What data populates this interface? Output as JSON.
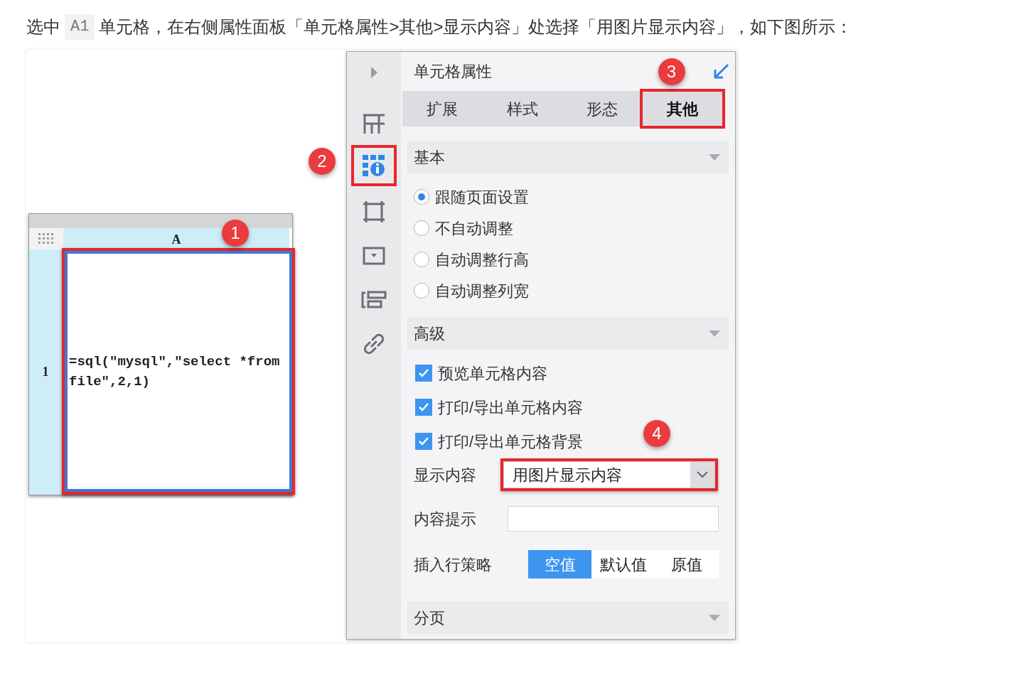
{
  "intro": {
    "before": "选中",
    "code": "A1",
    "after": "单元格，在右侧属性面板「单元格属性>其他>显示内容」处选择「用图片显示内容」，如下图所示："
  },
  "sheet": {
    "column_header": "A",
    "row_header": "1",
    "cell": {
      "value": "=sql(\"mysql\",\"select *from file\",2,1)",
      "selected": true,
      "highlighted": true,
      "badge": "1"
    }
  },
  "panel": {
    "title": "单元格属性",
    "rail_icons": [
      {
        "kind": "collapse",
        "selected": false,
        "highlighted": false
      },
      {
        "kind": "expand",
        "selected": false,
        "highlighted": false
      },
      {
        "kind": "cell-info",
        "selected": true,
        "highlighted": true,
        "badge": "2"
      },
      {
        "kind": "border",
        "selected": false,
        "highlighted": false
      },
      {
        "kind": "widget",
        "selected": false,
        "highlighted": false
      },
      {
        "kind": "condition",
        "selected": false,
        "highlighted": false
      },
      {
        "kind": "link",
        "selected": false,
        "highlighted": false
      }
    ],
    "tabs": [
      {
        "label": "扩展",
        "selected": false,
        "highlighted": false
      },
      {
        "label": "样式",
        "selected": false,
        "highlighted": false
      },
      {
        "label": "形态",
        "selected": false,
        "highlighted": false
      },
      {
        "label": "其他",
        "selected": true,
        "highlighted": true,
        "badge": "3"
      }
    ],
    "basic": {
      "title": "基本",
      "options": [
        {
          "label": "跟随页面设置",
          "selected": true
        },
        {
          "label": "不自动调整",
          "selected": false
        },
        {
          "label": "自动调整行高",
          "selected": false
        },
        {
          "label": "自动调整列宽",
          "selected": false
        }
      ]
    },
    "advanced": {
      "title": "高级",
      "checkboxes": [
        {
          "label": "预览单元格内容",
          "checked": true
        },
        {
          "label": "打印/导出单元格内容",
          "checked": true
        },
        {
          "label": "打印/导出单元格背景",
          "checked": true
        }
      ],
      "display": {
        "label": "显示内容",
        "value": "用图片显示内容",
        "highlighted": true,
        "badge": "4"
      },
      "hint": {
        "label": "内容提示"
      },
      "insert_policy": {
        "label": "插入行策略",
        "options": [
          {
            "label": "空值",
            "selected": true
          },
          {
            "label": "默认值",
            "selected": false
          },
          {
            "label": "原值",
            "selected": false
          }
        ]
      }
    },
    "paging": {
      "title": "分页"
    }
  }
}
